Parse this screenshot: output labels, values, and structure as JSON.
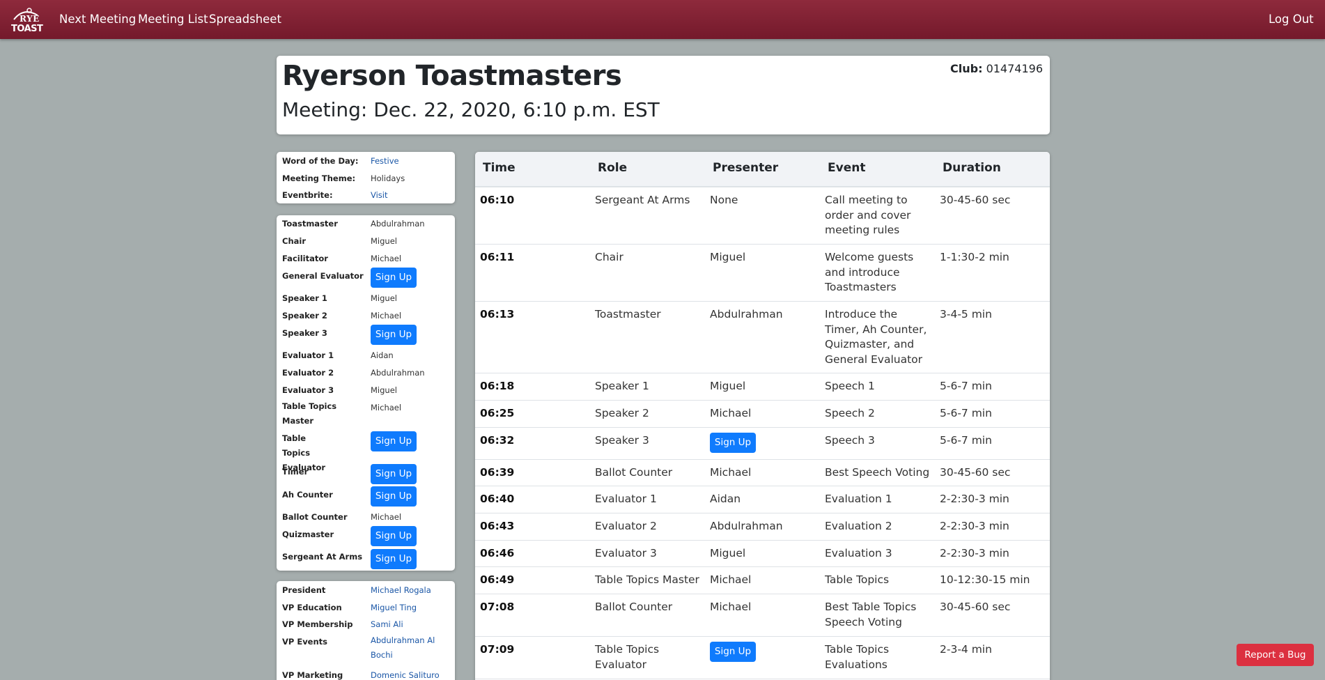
{
  "nav": {
    "logo_line1": "RYE",
    "logo_line2": "TOAST",
    "next_meeting": "Next Meeting",
    "meeting_list": "Meeting List",
    "spreadsheet": "Spreadsheet",
    "logout": "Log Out"
  },
  "header": {
    "title": "Ryerson Toastmasters",
    "meeting": "Meeting: Dec. 22, 2020, 6:10 p.m. EST",
    "club_label": "Club:",
    "club_number": "01474196"
  },
  "info": {
    "word_label": "Word of the Day:",
    "word_value": "Festive",
    "theme_label": "Meeting Theme:",
    "theme_value": "Holidays",
    "eventbrite_label": "Eventbrite:",
    "eventbrite_value": "Visit"
  },
  "sign_up_label": "Sign Up",
  "roles": [
    {
      "label": "Toastmaster",
      "value": "Abdulrahman"
    },
    {
      "label": "Chair",
      "value": "Miguel"
    },
    {
      "label": "Facilitator",
      "value": "Michael"
    },
    {
      "label": "General Evaluator",
      "value": ""
    },
    {
      "label": "Speaker 1",
      "value": "Miguel"
    },
    {
      "label": "Speaker 2",
      "value": "Michael"
    },
    {
      "label": "Speaker 3",
      "value": ""
    },
    {
      "label": "Evaluator 1",
      "value": "Aidan"
    },
    {
      "label": "Evaluator 2",
      "value": "Abdulrahman"
    },
    {
      "label": "Evaluator 3",
      "value": "Miguel"
    },
    {
      "label": "Table Topics Master",
      "value": "Michael"
    },
    {
      "label": "Table Topics Evaluator",
      "value": ""
    },
    {
      "label": "Timer",
      "value": ""
    },
    {
      "label": "Ah Counter",
      "value": ""
    },
    {
      "label": "Ballot Counter",
      "value": "Michael"
    },
    {
      "label": "Quizmaster",
      "value": ""
    },
    {
      "label": "Sergeant At Arms",
      "value": ""
    }
  ],
  "execs": [
    {
      "label": "President",
      "value": "Michael Rogala"
    },
    {
      "label": "VP Education",
      "value": "Miguel Ting"
    },
    {
      "label": "VP Membership",
      "value": "Sami Ali"
    },
    {
      "label": "VP Events",
      "value": "Abdulrahman Al Bochi"
    },
    {
      "label": "VP Marketing",
      "value": "Domenic Salituro"
    }
  ],
  "schedule": {
    "headers": [
      "Time",
      "Role",
      "Presenter",
      "Event",
      "Duration"
    ],
    "rows": [
      {
        "time": "06:10",
        "role": "Sergeant At Arms",
        "presenter": "None",
        "event": "Call meeting to order and cover meeting rules",
        "duration": "30-45-60 sec"
      },
      {
        "time": "06:11",
        "role": "Chair",
        "presenter": "Miguel",
        "event": "Welcome guests and introduce Toastmasters",
        "duration": "1-1:30-2 min"
      },
      {
        "time": "06:13",
        "role": "Toastmaster",
        "presenter": "Abdulrahman",
        "event": "Introduce the Timer, Ah Counter, Quizmaster, and General Evaluator",
        "duration": "3-4-5 min"
      },
      {
        "time": "06:18",
        "role": "Speaker 1",
        "presenter": "Miguel",
        "event": "Speech 1",
        "duration": "5-6-7 min"
      },
      {
        "time": "06:25",
        "role": "Speaker 2",
        "presenter": "Michael",
        "event": "Speech 2",
        "duration": "5-6-7 min"
      },
      {
        "time": "06:32",
        "role": "Speaker 3",
        "presenter": "",
        "event": "Speech 3",
        "duration": "5-6-7 min"
      },
      {
        "time": "06:39",
        "role": "Ballot Counter",
        "presenter": "Michael",
        "event": "Best Speech Voting",
        "duration": "30-45-60 sec"
      },
      {
        "time": "06:40",
        "role": "Evaluator 1",
        "presenter": "Aidan",
        "event": "Evaluation 1",
        "duration": "2-2:30-3 min"
      },
      {
        "time": "06:43",
        "role": "Evaluator 2",
        "presenter": "Abdulrahman",
        "event": "Evaluation 2",
        "duration": "2-2:30-3 min"
      },
      {
        "time": "06:46",
        "role": "Evaluator 3",
        "presenter": "Miguel",
        "event": "Evaluation 3",
        "duration": "2-2:30-3 min"
      },
      {
        "time": "06:49",
        "role": "Table Topics Master",
        "presenter": "Michael",
        "event": "Table Topics",
        "duration": "10-12:30-15 min"
      },
      {
        "time": "07:08",
        "role": "Ballot Counter",
        "presenter": "Michael",
        "event": "Best Table Topics Speech Voting",
        "duration": "30-45-60 sec"
      },
      {
        "time": "07:09",
        "role": "Table Topics Evaluator",
        "presenter": "",
        "event": "Table Topics Evaluations",
        "duration": "2-3-4 min"
      }
    ]
  },
  "report_bug": "Report a Bug"
}
